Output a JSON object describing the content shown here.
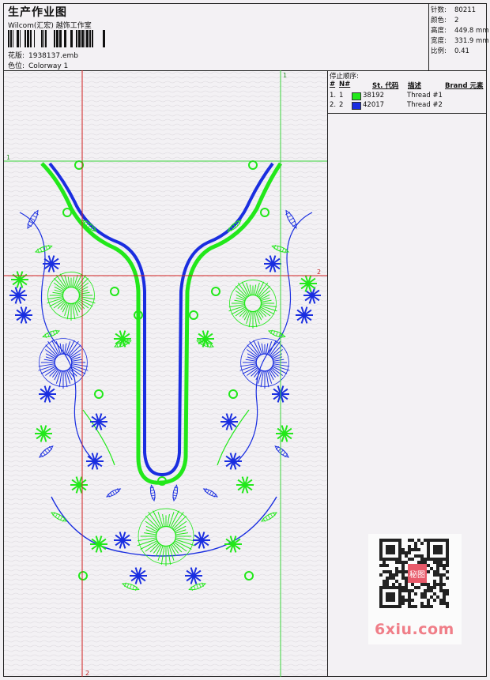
{
  "header": {
    "title": "生产作业图",
    "company": "Wilcom(汇宏) 越饰工作室",
    "design_label": "花版:",
    "design_value": "1938137.emb",
    "colorway_label": "色位:",
    "colorway_value": "Colorway 1"
  },
  "stats": [
    {
      "label": "针数:",
      "value": "80211"
    },
    {
      "label": "颜色:",
      "value": "2"
    },
    {
      "label": "高度:",
      "value": "449.8 mm"
    },
    {
      "label": "宽度:",
      "value": "331.9 mm"
    },
    {
      "label": "比例:",
      "value": "0.41"
    }
  ],
  "stop_sequence": {
    "title": "停止顺序:",
    "columns": {
      "num": "#",
      "n": "N#",
      "code": "St. 代码",
      "desc": "描述",
      "brand": "Brand 元素"
    },
    "rows": [
      {
        "num": "1.",
        "n": "1",
        "color": "#22e81a",
        "code": "38192",
        "desc": "Thread #1"
      },
      {
        "num": "2.",
        "n": "2",
        "color": "#1a2ee0",
        "code": "42017",
        "desc": "Thread #2"
      }
    ]
  },
  "guides": {
    "green_label_1_top": "1",
    "green_label_1_left": "1",
    "red_label_2_right": "2",
    "red_label_2_bottom": "2",
    "green_color": "#39d43a",
    "red_color": "#d02020"
  },
  "colors": {
    "thread1": "#22e81a",
    "thread2": "#1a2ee0"
  },
  "watermark": {
    "text": "6xiu.com",
    "stamp": "秘图"
  }
}
